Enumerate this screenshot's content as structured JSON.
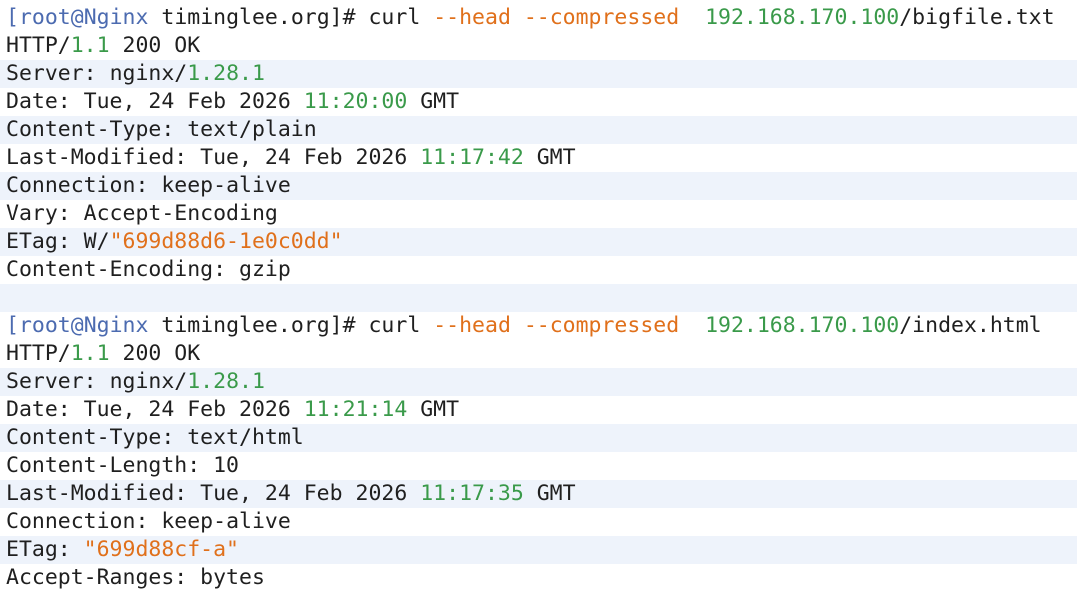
{
  "block1": {
    "prompt": {
      "open": "[",
      "user": "root",
      "at": "@",
      "host": "Nginx",
      "space": " ",
      "dir": "timinglee.org",
      "close": "]#",
      "cmd": " curl ",
      "flags": "--head --compressed",
      "sep": "  ",
      "ip": "192.168.170.100",
      "path": "/bigfile.txt"
    },
    "status": {
      "proto": "HTTP/",
      "ver": "1.1",
      "rest": " 200 OK"
    },
    "server": {
      "key": "Server",
      "colon": ": ",
      "name": "nginx/",
      "ver": "1.28.1"
    },
    "date": {
      "key": "Date",
      "colon": ": ",
      "pre": "Tue, 24 Feb 2026 ",
      "time": "11:20:00",
      "post": " GMT"
    },
    "content_type": {
      "key": "Content-Type",
      "colon": ": ",
      "value": "text/plain"
    },
    "last_modified": {
      "key": "Last-Modified",
      "colon": ": ",
      "pre": "Tue, 24 Feb 2026 ",
      "time": "11:17:42",
      "post": " GMT"
    },
    "connection": {
      "key": "Connection",
      "colon": ": ",
      "value": "keep-alive"
    },
    "vary": {
      "key": "Vary",
      "colon": ": ",
      "value": "Accept-Encoding"
    },
    "etag": {
      "key": "ETag",
      "colon": ": ",
      "prefix": "W/",
      "value": "\"699d88d6-1e0c0dd\""
    },
    "content_encoding": {
      "key": "Content-Encoding",
      "colon": ": ",
      "value": "gzip"
    }
  },
  "block2": {
    "prompt": {
      "open": "[",
      "user": "root",
      "at": "@",
      "host": "Nginx",
      "space": " ",
      "dir": "timinglee.org",
      "close": "]#",
      "cmd": " curl ",
      "flags": "--head --compressed",
      "sep": "  ",
      "ip": "192.168.170.100",
      "path": "/index.html"
    },
    "status": {
      "proto": "HTTP/",
      "ver": "1.1",
      "rest": " 200 OK"
    },
    "server": {
      "key": "Server",
      "colon": ": ",
      "name": "nginx/",
      "ver": "1.28.1"
    },
    "date": {
      "key": "Date",
      "colon": ": ",
      "pre": "Tue, 24 Feb 2026 ",
      "time": "11:21:14",
      "post": " GMT"
    },
    "content_type": {
      "key": "Content-Type",
      "colon": ": ",
      "value": "text/html"
    },
    "content_length": {
      "key": "Content-Length",
      "colon": ": ",
      "value": "10"
    },
    "last_modified": {
      "key": "Last-Modified",
      "colon": ": ",
      "pre": "Tue, 24 Feb 2026 ",
      "time": "11:17:35",
      "post": " GMT"
    },
    "connection": {
      "key": "Connection",
      "colon": ": ",
      "value": "keep-alive"
    },
    "etag": {
      "key": "ETag",
      "colon": ": ",
      "value": "\"699d88cf-a\""
    },
    "accept_ranges": {
      "key": "Accept-Ranges",
      "colon": ": ",
      "value": "bytes"
    }
  },
  "colors": {
    "prompt": "#4c6bb0",
    "number": "#3a9a4a",
    "string": "#e0701b",
    "row_alt": "#eef3fb"
  }
}
